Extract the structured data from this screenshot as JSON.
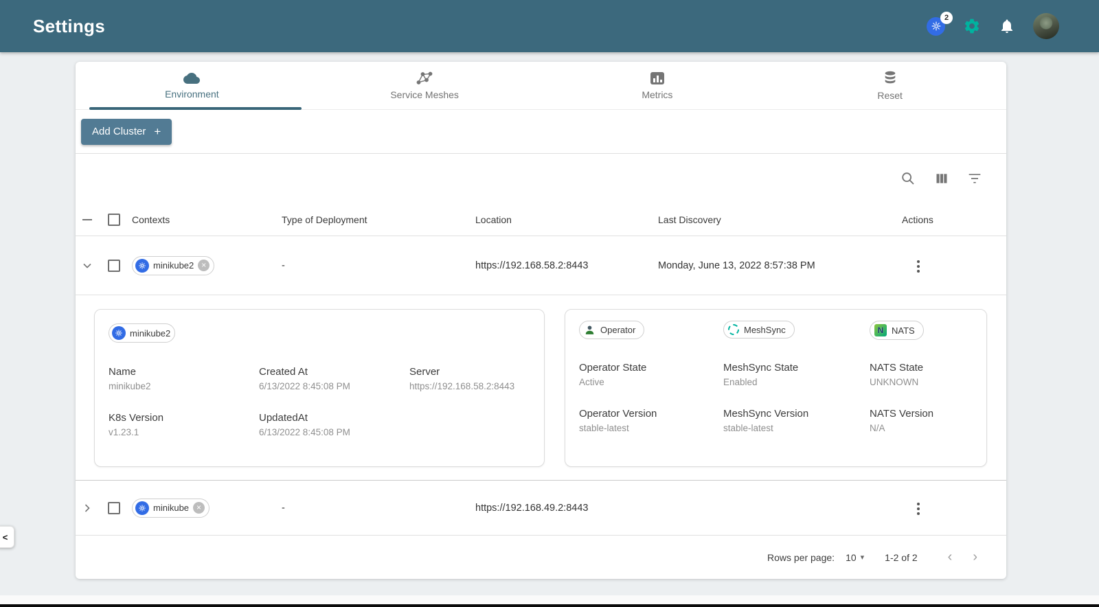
{
  "colors": {
    "header_bg": "#3C697D",
    "accent_teal": "#00B39F",
    "k8s_blue": "#326CE5",
    "tab_active": "#396679",
    "add_button_bg": "#527B94"
  },
  "header": {
    "title": "Settings",
    "k8s_context_count": "2"
  },
  "tabs": [
    {
      "label": "Environment",
      "active": true
    },
    {
      "label": "Service Meshes",
      "active": false
    },
    {
      "label": "Metrics",
      "active": false
    },
    {
      "label": "Reset",
      "active": false
    }
  ],
  "actions_bar": {
    "add_cluster_label": "Add Cluster",
    "add_cluster_plus": "+"
  },
  "table": {
    "columns": [
      "Contexts",
      "Type of Deployment",
      "Location",
      "Last Discovery",
      "Actions"
    ],
    "rows": [
      {
        "context": "minikube2",
        "type_of_deployment": "-",
        "location": "https://192.168.58.2:8443",
        "last_discovery": "Monday, June 13, 2022 8:57:38 PM",
        "expanded": true
      },
      {
        "context": "minikube",
        "type_of_deployment": "-",
        "location": "https://192.168.49.2:8443",
        "last_discovery": "",
        "expanded": false
      }
    ]
  },
  "details": {
    "chip": "minikube2",
    "left_fields": [
      {
        "label": "Name",
        "value": "minikube2"
      },
      {
        "label": "Created At",
        "value": "6/13/2022 8:45:08 PM"
      },
      {
        "label": "Server",
        "value": "https://192.168.58.2:8443"
      },
      {
        "label": "K8s Version",
        "value": "v1.23.1"
      },
      {
        "label": "UpdatedAt",
        "value": "6/13/2022 8:45:08 PM"
      }
    ],
    "component_chips": [
      "Operator",
      "MeshSync",
      "NATS"
    ],
    "nats_logo_letter": "N",
    "right_fields": [
      {
        "label": "Operator State",
        "value": "Active"
      },
      {
        "label": "MeshSync State",
        "value": "Enabled"
      },
      {
        "label": "NATS State",
        "value": "UNKNOWN"
      },
      {
        "label": "Operator Version",
        "value": "stable-latest"
      },
      {
        "label": "MeshSync Version",
        "value": "stable-latest"
      },
      {
        "label": "NATS Version",
        "value": "N/A"
      }
    ]
  },
  "pagination": {
    "rows_per_page_label": "Rows per page:",
    "rows_per_page_value": "10",
    "caret": "▾",
    "range": "1-2 of 2",
    "prev": "‹",
    "next": "›"
  },
  "misc": {
    "chip_close_glyph": "×",
    "drawer_toggle_glyph": "<"
  },
  "icons": {
    "kubernetes": "k8s-wheel-on-blue-circle",
    "settings_gear": "gear-teal",
    "notifications": "bell-white",
    "environment_tab": "cloud",
    "service_meshes_tab": "mesh-nodes",
    "metrics_tab": "bar-chart-square",
    "reset_tab": "database",
    "search": "magnifier",
    "view_columns": "three-columns",
    "filter": "funnel-lines",
    "operator_chip": "person",
    "meshsync_chip": "dashed-ring",
    "nats_chip": "nats-logo",
    "actions_menu": "vertical-dots"
  }
}
